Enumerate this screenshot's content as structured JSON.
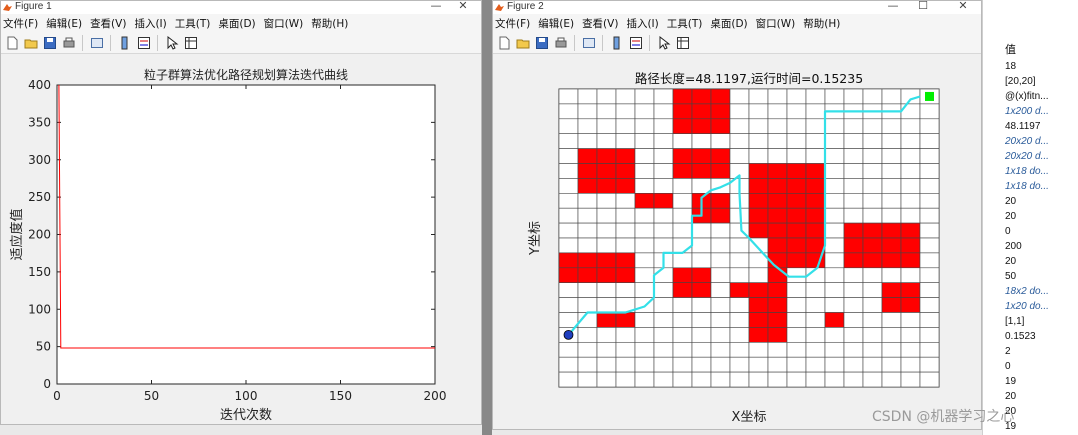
{
  "figure1": {
    "window_title": "Figure 1",
    "menu": [
      "文件(F)",
      "编辑(E)",
      "查看(V)",
      "插入(I)",
      "工具(T)",
      "桌面(D)",
      "窗口(W)",
      "帮助(H)"
    ],
    "toolbar_icons": [
      "new-figure-icon",
      "open-file-icon",
      "save-icon",
      "print-icon",
      "link-plot-icon",
      "colorbar-icon",
      "legend-icon",
      "pointer-icon",
      "property-editor-icon"
    ],
    "window_buttons": [
      "—",
      "✕"
    ],
    "chart_data": {
      "type": "line",
      "title": "粒子群算法优化路径规划算法迭代曲线",
      "xlabel": "迭代次数",
      "ylabel": "适应度值",
      "xlim": [
        0,
        200
      ],
      "ylim": [
        0,
        400
      ],
      "xticks": [
        "0",
        "50",
        "100",
        "150",
        "200"
      ],
      "yticks": [
        "0",
        "50",
        "100",
        "150",
        "200",
        "250",
        "300",
        "350",
        "400"
      ],
      "series": [
        {
          "color": "#ff0000",
          "x": [
            1,
            2,
            200
          ],
          "y": [
            400,
            48.1197,
            48.1197
          ]
        }
      ],
      "grid": false
    }
  },
  "figure2": {
    "window_title": "Figure 2",
    "menu": [
      "文件(F)",
      "编辑(E)",
      "查看(V)",
      "插入(I)",
      "工具(T)",
      "桌面(D)",
      "窗口(W)",
      "帮助(H)"
    ],
    "toolbar_icons": [
      "new-figure-icon",
      "open-file-icon",
      "save-icon",
      "print-icon",
      "link-plot-icon",
      "colorbar-icon",
      "legend-icon",
      "pointer-icon",
      "property-editor-icon"
    ],
    "window_buttons": [
      "—",
      "☐",
      "✕"
    ],
    "chart_data": {
      "type": "heatmap",
      "title": "路径长度=48.1197,运行时间=0.15235",
      "xlabel": "X坐标",
      "ylabel": "Y坐标",
      "grid_size": [
        20,
        20
      ],
      "obstacle_color": "#ff0000",
      "free_color": "#ffffff",
      "obstacles": [
        [
          6,
          0
        ],
        [
          7,
          0
        ],
        [
          8,
          0
        ],
        [
          6,
          1
        ],
        [
          7,
          1
        ],
        [
          8,
          1
        ],
        [
          6,
          2
        ],
        [
          7,
          2
        ],
        [
          8,
          2
        ],
        [
          1,
          4
        ],
        [
          2,
          4
        ],
        [
          3,
          4
        ],
        [
          6,
          4
        ],
        [
          7,
          4
        ],
        [
          8,
          4
        ],
        [
          1,
          5
        ],
        [
          2,
          5
        ],
        [
          3,
          5
        ],
        [
          6,
          5
        ],
        [
          7,
          5
        ],
        [
          8,
          5
        ],
        [
          1,
          6
        ],
        [
          2,
          6
        ],
        [
          3,
          6
        ],
        [
          10,
          5
        ],
        [
          11,
          5
        ],
        [
          12,
          5
        ],
        [
          13,
          5
        ],
        [
          10,
          6
        ],
        [
          11,
          6
        ],
        [
          12,
          6
        ],
        [
          13,
          6
        ],
        [
          10,
          7
        ],
        [
          11,
          7
        ],
        [
          12,
          7
        ],
        [
          13,
          7
        ],
        [
          10,
          8
        ],
        [
          11,
          8
        ],
        [
          12,
          8
        ],
        [
          13,
          8
        ],
        [
          10,
          9
        ],
        [
          11,
          9
        ],
        [
          12,
          9
        ],
        [
          13,
          9
        ],
        [
          11,
          10
        ],
        [
          12,
          10
        ],
        [
          13,
          10
        ],
        [
          11,
          11
        ],
        [
          12,
          11
        ],
        [
          13,
          11
        ],
        [
          4,
          7
        ],
        [
          5,
          7
        ],
        [
          7,
          7
        ],
        [
          8,
          7
        ],
        [
          7,
          8
        ],
        [
          8,
          8
        ],
        [
          15,
          9
        ],
        [
          16,
          9
        ],
        [
          17,
          9
        ],
        [
          18,
          9
        ],
        [
          15,
          10
        ],
        [
          16,
          10
        ],
        [
          17,
          10
        ],
        [
          18,
          10
        ],
        [
          15,
          11
        ],
        [
          16,
          11
        ],
        [
          17,
          11
        ],
        [
          18,
          11
        ],
        [
          0,
          11
        ],
        [
          1,
          11
        ],
        [
          2,
          11
        ],
        [
          3,
          11
        ],
        [
          0,
          12
        ],
        [
          1,
          12
        ],
        [
          2,
          12
        ],
        [
          3,
          12
        ],
        [
          6,
          12
        ],
        [
          7,
          12
        ],
        [
          6,
          13
        ],
        [
          7,
          13
        ],
        [
          11,
          12
        ],
        [
          9,
          13
        ],
        [
          10,
          13
        ],
        [
          11,
          13
        ],
        [
          17,
          13
        ],
        [
          18,
          13
        ],
        [
          17,
          14
        ],
        [
          18,
          14
        ],
        [
          2,
          15
        ],
        [
          3,
          15
        ],
        [
          10,
          14
        ],
        [
          11,
          14
        ],
        [
          10,
          15
        ],
        [
          11,
          15
        ],
        [
          10,
          16
        ],
        [
          11,
          16
        ],
        [
          14,
          15
        ]
      ],
      "path_color": "#33e0e8",
      "path": [
        [
          0.5,
          16.5
        ],
        [
          1.5,
          15
        ],
        [
          3.5,
          15
        ],
        [
          4.5,
          14.6
        ],
        [
          5,
          14
        ],
        [
          5,
          12.5
        ],
        [
          5.5,
          12
        ],
        [
          5.5,
          11
        ],
        [
          6.5,
          11
        ],
        [
          7,
          10.5
        ],
        [
          7,
          9
        ],
        [
          7,
          8.5
        ],
        [
          7.5,
          8.5
        ],
        [
          7.5,
          7.3
        ],
        [
          8,
          6.8
        ],
        [
          8.5,
          6.6
        ],
        [
          9,
          6.3
        ],
        [
          9.5,
          5.8
        ],
        [
          9.5,
          7
        ],
        [
          9.6,
          9.5
        ],
        [
          10,
          10
        ],
        [
          10.5,
          10.7
        ],
        [
          11.3,
          11.8
        ],
        [
          12.1,
          12.6
        ],
        [
          13,
          12.6
        ],
        [
          13.6,
          12
        ],
        [
          14,
          10.5
        ],
        [
          14,
          1.5
        ],
        [
          18,
          1.5
        ],
        [
          18.5,
          0.7
        ],
        [
          19,
          0.5
        ]
      ],
      "start": {
        "cell": [
          0,
          16
        ],
        "marker_color": "#1f3fbf",
        "marker": "circle"
      },
      "goal": {
        "cell": [
          19,
          0
        ],
        "marker_color": "#00ee00",
        "marker": "square"
      }
    }
  },
  "workspace": {
    "header": "值",
    "values": [
      {
        "text": "18",
        "italic": false
      },
      {
        "text": "[20,20]",
        "italic": false
      },
      {
        "text": "@(x)fitn...",
        "italic": false
      },
      {
        "text": "1x200 d...",
        "italic": true
      },
      {
        "text": "48.1197",
        "italic": false
      },
      {
        "text": "20x20 d...",
        "italic": true
      },
      {
        "text": "20x20 d...",
        "italic": true
      },
      {
        "text": "1x18 do...",
        "italic": true
      },
      {
        "text": "1x18 do...",
        "italic": true
      },
      {
        "text": "20",
        "italic": false
      },
      {
        "text": "20",
        "italic": false
      },
      {
        "text": "0",
        "italic": false
      },
      {
        "text": "200",
        "italic": false
      },
      {
        "text": "20",
        "italic": false
      },
      {
        "text": "50",
        "italic": false
      },
      {
        "text": "18x2 do...",
        "italic": true
      },
      {
        "text": "1x20 do...",
        "italic": true
      },
      {
        "text": "[1,1]",
        "italic": false
      },
      {
        "text": "0.1523",
        "italic": false
      },
      {
        "text": "2",
        "italic": false
      },
      {
        "text": "0",
        "italic": false
      },
      {
        "text": "19",
        "italic": false
      },
      {
        "text": "20",
        "italic": false
      },
      {
        "text": "20",
        "italic": false
      },
      {
        "text": "19",
        "italic": false
      }
    ]
  },
  "watermark": "CSDN @机器学习之心"
}
